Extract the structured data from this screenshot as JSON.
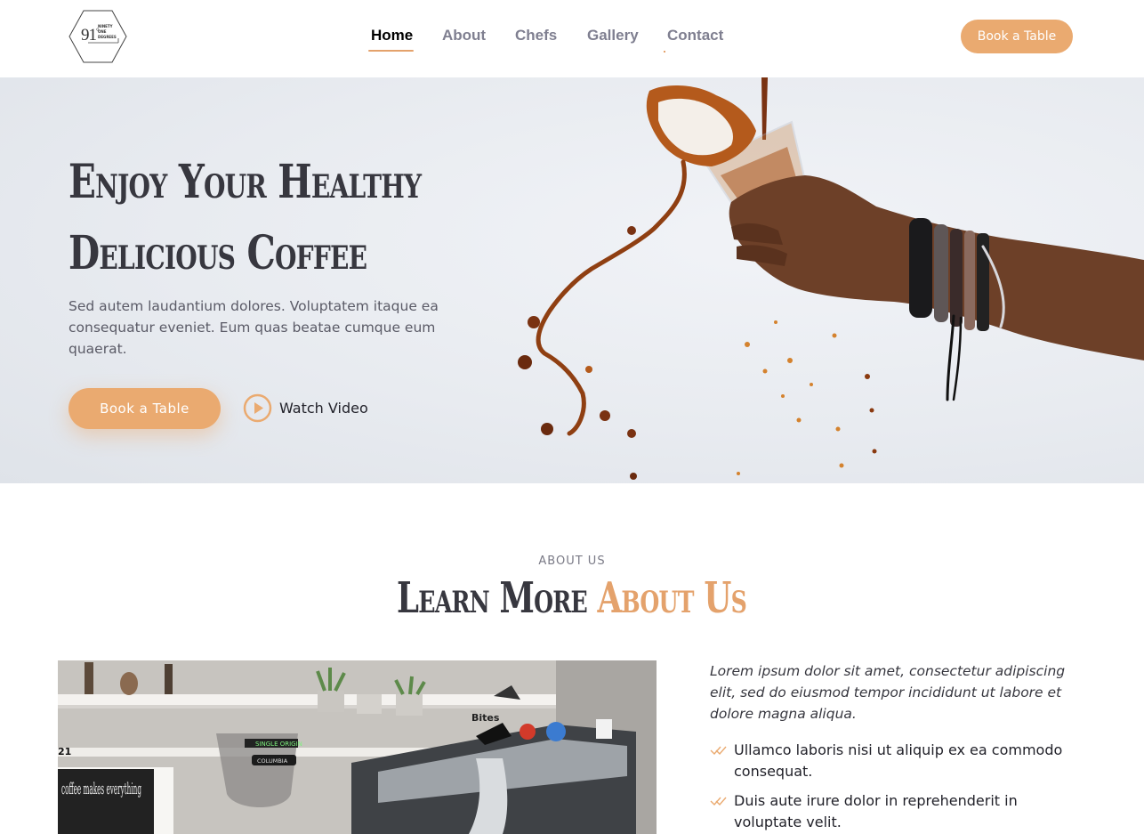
{
  "header": {
    "logo": {
      "number": "91",
      "degree_mark": "°",
      "text": "NINETY ONE DEGREES"
    },
    "nav": [
      {
        "label": "Home",
        "active": true
      },
      {
        "label": "About",
        "active": false
      },
      {
        "label": "Chefs",
        "active": false
      },
      {
        "label": "Gallery",
        "active": false
      },
      {
        "label": "Contact",
        "active": false
      }
    ],
    "cta_label": "Book a Table"
  },
  "hero": {
    "title_line1": "Enjoy Your Healthy",
    "title_line2": "Delicious Coffee",
    "description": "Sed autem laudantium dolores. Voluptatem itaque ea consequatur eveniet. Eum quas beatae cumque eum quaerat.",
    "book_label": "Book a Table",
    "watch_label": "Watch Video"
  },
  "about": {
    "kicker": "ABOUT US",
    "title_plain": "Learn More",
    "title_accent": "About Us",
    "lead": "Lorem ipsum dolor sit amet, consectetur adipiscing elit, sed do eiusmod tempor incididunt ut labore et dolore magna aliqua.",
    "checklist": [
      "Ullamco laboris nisi ut aliquip ex ea commodo consequat.",
      "Duis aute irure dolor in reprehenderit in voluptate velit."
    ],
    "photo_labels": {
      "grinder_tag": "SINGLE ORIGIN",
      "grinder_sub": "COLUMBIA",
      "menu": "Bites",
      "chalk": "coffee makes everything",
      "counter": "21"
    }
  },
  "colors": {
    "accent": "#eaaa70",
    "heading": "#37373f",
    "nav_inactive": "#7f7f90"
  },
  "icons": {
    "play": "play-circle-icon",
    "check": "double-check-icon"
  }
}
